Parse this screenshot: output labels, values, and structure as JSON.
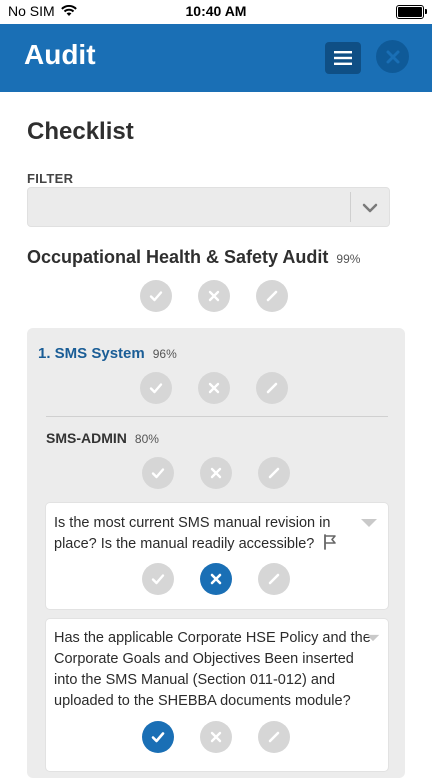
{
  "status_bar": {
    "carrier": "No SIM",
    "time": "10:40 AM"
  },
  "header": {
    "title": "Audit"
  },
  "page": {
    "title": "Checklist"
  },
  "filter": {
    "label": "FILTER",
    "value": ""
  },
  "audit": {
    "title": "Occupational Health & Safety Audit",
    "percent": "99%"
  },
  "section": {
    "title": "1. SMS System",
    "percent": "96%"
  },
  "subsection": {
    "title": "SMS-ADMIN",
    "percent": "80%"
  },
  "questions": [
    {
      "text": "Is the most current SMS manual revision in place? Is the manual readily accessible?",
      "selected": "fail"
    },
    {
      "text": "Has the applicable Corporate HSE Policy and the Corporate Goals and Objectives Been inserted into the SMS Manual (Section 011-012) and uploaded to the SHEBBA documents module?",
      "selected": "pass"
    }
  ],
  "icons": {
    "pass": "check-icon",
    "fail": "x-icon",
    "na": "slash-icon",
    "flag": "flag-icon"
  },
  "colors": {
    "brand": "#1a6fb5",
    "inactive": "#d6d6d6"
  }
}
